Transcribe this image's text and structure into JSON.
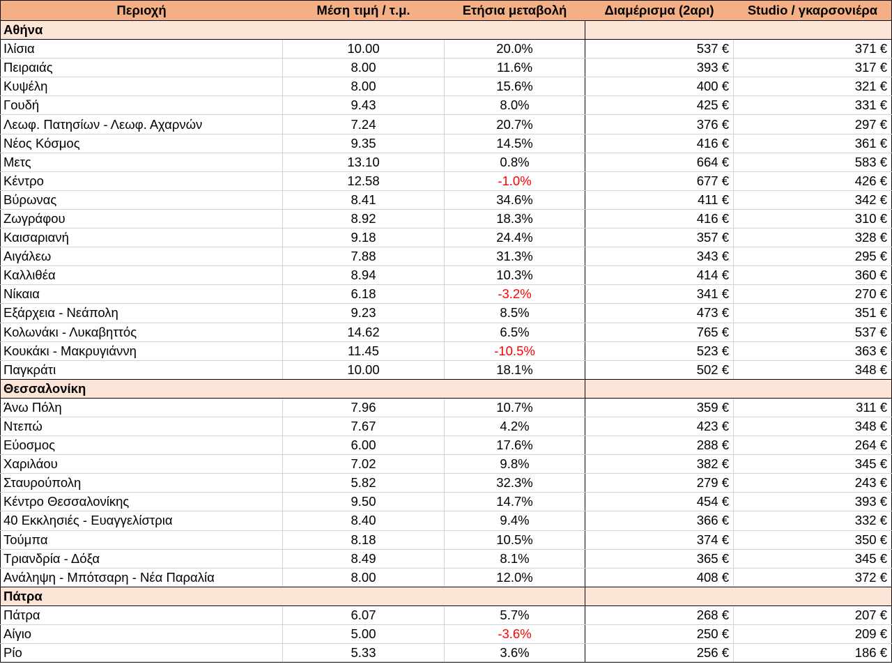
{
  "table": {
    "columns": [
      "Περιοχή",
      "Μέση τιμή / τ.μ.",
      "Ετήσια μεταβολή",
      "Διαμέρισμα (2αρι)",
      "Studio / γκαρσονιέρα"
    ],
    "groups": [
      {
        "name": "Αθήνα",
        "rows": [
          {
            "area": "Ιλίσια",
            "price_per_sqm": "10.00",
            "annual_change": "20.0%",
            "apartment_2room": "537 €",
            "studio": "371 €"
          },
          {
            "area": "Πειραιάς",
            "price_per_sqm": "8.00",
            "annual_change": "11.6%",
            "apartment_2room": "393 €",
            "studio": "317 €"
          },
          {
            "area": "Κυψέλη",
            "price_per_sqm": "8.00",
            "annual_change": "15.6%",
            "apartment_2room": "400 €",
            "studio": "321 €"
          },
          {
            "area": "Γουδή",
            "price_per_sqm": "9.43",
            "annual_change": "8.0%",
            "apartment_2room": "425 €",
            "studio": "331 €"
          },
          {
            "area": "Λεωφ. Πατησίων - Λεωφ. Αχαρνών",
            "price_per_sqm": "7.24",
            "annual_change": "20.7%",
            "apartment_2room": "376 €",
            "studio": "297 €"
          },
          {
            "area": "Νέος Κόσμος",
            "price_per_sqm": "9.35",
            "annual_change": "14.5%",
            "apartment_2room": "416 €",
            "studio": "361 €"
          },
          {
            "area": "Μετς",
            "price_per_sqm": "13.10",
            "annual_change": "0.8%",
            "apartment_2room": "664 €",
            "studio": "583 €"
          },
          {
            "area": "Κέντρο",
            "price_per_sqm": "12.58",
            "annual_change": "-1.0%",
            "apartment_2room": "677 €",
            "studio": "426 €"
          },
          {
            "area": "Βύρωνας",
            "price_per_sqm": "8.41",
            "annual_change": "34.6%",
            "apartment_2room": "411 €",
            "studio": "342 €"
          },
          {
            "area": "Ζωγράφου",
            "price_per_sqm": "8.92",
            "annual_change": "18.3%",
            "apartment_2room": "416 €",
            "studio": "310 €"
          },
          {
            "area": "Καισαριανή",
            "price_per_sqm": "9.18",
            "annual_change": "24.4%",
            "apartment_2room": "357 €",
            "studio": "328 €"
          },
          {
            "area": "Αιγάλεω",
            "price_per_sqm": "7.88",
            "annual_change": "31.3%",
            "apartment_2room": "343 €",
            "studio": "295 €"
          },
          {
            "area": "Καλλιθέα",
            "price_per_sqm": "8.94",
            "annual_change": "10.3%",
            "apartment_2room": "414 €",
            "studio": "360 €"
          },
          {
            "area": "Νίκαια",
            "price_per_sqm": "6.18",
            "annual_change": "-3.2%",
            "apartment_2room": "341 €",
            "studio": "270 €"
          },
          {
            "area": "Εξάρχεια - Νεάπολη",
            "price_per_sqm": "9.23",
            "annual_change": "8.5%",
            "apartment_2room": "473 €",
            "studio": "351 €"
          },
          {
            "area": "Κολωνάκι - Λυκαβηττός",
            "price_per_sqm": "14.62",
            "annual_change": "6.5%",
            "apartment_2room": "765 €",
            "studio": "537 €"
          },
          {
            "area": "Κουκάκι - Μακρυγιάννη",
            "price_per_sqm": "11.45",
            "annual_change": "-10.5%",
            "apartment_2room": "523 €",
            "studio": "363 €"
          },
          {
            "area": "Παγκράτι",
            "price_per_sqm": "10.00",
            "annual_change": "18.1%",
            "apartment_2room": "502 €",
            "studio": "348 €"
          }
        ]
      },
      {
        "name": "Θεσσαλονίκη",
        "rows": [
          {
            "area": "Άνω Πόλη",
            "price_per_sqm": "7.96",
            "annual_change": "10.7%",
            "apartment_2room": "359 €",
            "studio": "311 €"
          },
          {
            "area": "Ντεπώ",
            "price_per_sqm": "7.67",
            "annual_change": "4.2%",
            "apartment_2room": "423 €",
            "studio": "348 €"
          },
          {
            "area": "Εύοσμος",
            "price_per_sqm": "6.00",
            "annual_change": "17.6%",
            "apartment_2room": "288 €",
            "studio": "264 €"
          },
          {
            "area": "Χαριλάου",
            "price_per_sqm": "7.02",
            "annual_change": "9.8%",
            "apartment_2room": "382 €",
            "studio": "345 €"
          },
          {
            "area": "Σταυρούπολη",
            "price_per_sqm": "5.82",
            "annual_change": "32.3%",
            "apartment_2room": "279 €",
            "studio": "243 €"
          },
          {
            "area": "Κέντρο Θεσσαλονίκης",
            "price_per_sqm": "9.50",
            "annual_change": "14.7%",
            "apartment_2room": "454 €",
            "studio": "393 €"
          },
          {
            "area": "40 Εκκλησιές - Ευαγγελίστρια",
            "price_per_sqm": "8.40",
            "annual_change": "9.4%",
            "apartment_2room": "366 €",
            "studio": "332 €"
          },
          {
            "area": "Τούμπα",
            "price_per_sqm": "8.18",
            "annual_change": "10.5%",
            "apartment_2room": "374 €",
            "studio": "350 €"
          },
          {
            "area": "Τριανδρία - Δόξα",
            "price_per_sqm": "8.49",
            "annual_change": "8.1%",
            "apartment_2room": "365 €",
            "studio": "345 €"
          },
          {
            "area": "Ανάληψη - Μπότσαρη - Νέα Παραλία",
            "price_per_sqm": "8.00",
            "annual_change": "12.0%",
            "apartment_2room": "408 €",
            "studio": "372 €"
          }
        ]
      },
      {
        "name": "Πάτρα",
        "rows": [
          {
            "area": "Πάτρα",
            "price_per_sqm": "6.07",
            "annual_change": "5.7%",
            "apartment_2room": "268 €",
            "studio": "207 €"
          },
          {
            "area": "Αίγιο",
            "price_per_sqm": "5.00",
            "annual_change": "-3.6%",
            "apartment_2room": "250 €",
            "studio": "209 €"
          },
          {
            "area": "Ρίο",
            "price_per_sqm": "5.33",
            "annual_change": "3.6%",
            "apartment_2room": "256 €",
            "studio": "186 €"
          }
        ]
      }
    ]
  },
  "colors": {
    "header_bg": "#F4B084",
    "section_bg": "#FCE4D6",
    "negative_text": "#FF0000",
    "text": "#000000"
  }
}
